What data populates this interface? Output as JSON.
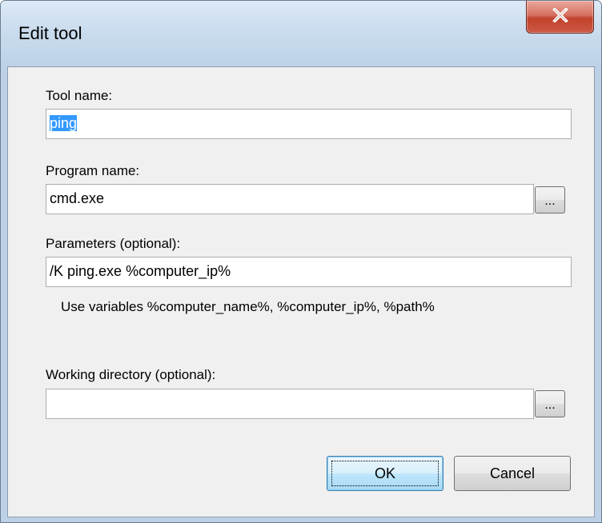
{
  "window": {
    "title": "Edit tool",
    "close_label": "close"
  },
  "form": {
    "tool_name": {
      "label": "Tool name:",
      "value": "ping"
    },
    "program_name": {
      "label": "Program name:",
      "value": "cmd.exe",
      "browse_label": "..."
    },
    "parameters": {
      "label": "Parameters (optional):",
      "value": "/K ping.exe %computer_ip%",
      "hint": "Use variables %computer_name%, %computer_ip%, %path%"
    },
    "working_directory": {
      "label": "Working directory (optional):",
      "value": "",
      "browse_label": "..."
    }
  },
  "buttons": {
    "ok": "OK",
    "cancel": "Cancel"
  },
  "icons": {
    "close": "close-icon"
  },
  "colors": {
    "selection": "#3399ff",
    "close_button": "#c2412c",
    "default_button_border": "#3c7fb1"
  }
}
